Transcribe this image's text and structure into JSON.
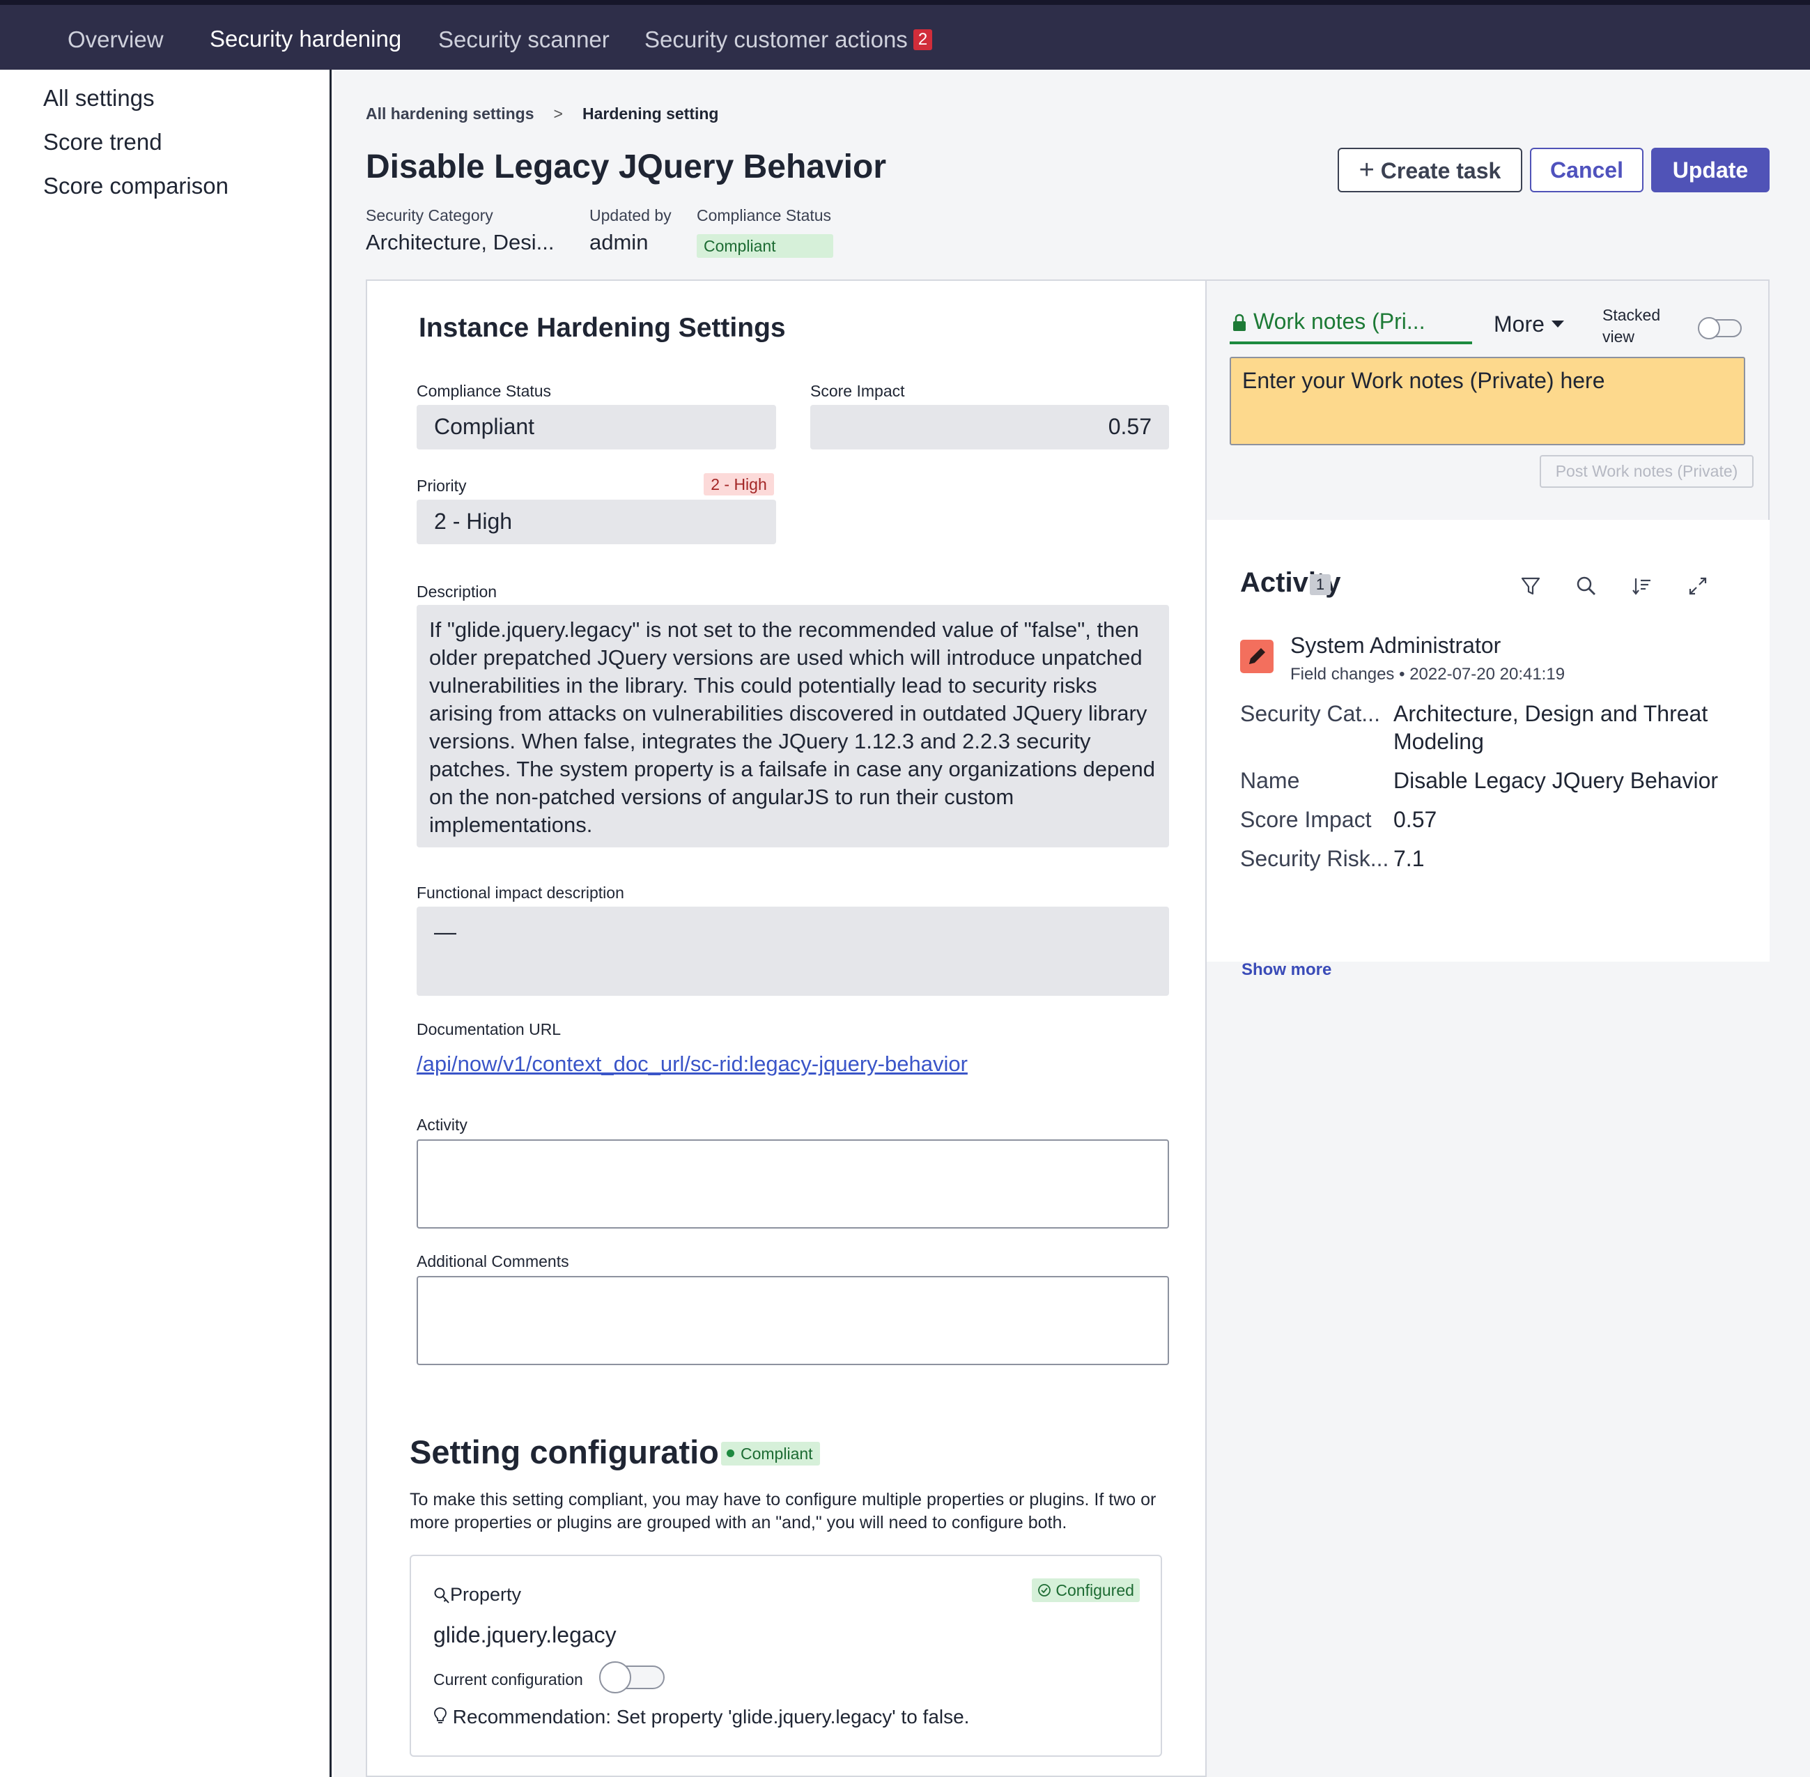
{
  "nav": {
    "tabs": [
      {
        "label": "Overview"
      },
      {
        "label": "Security hardening"
      },
      {
        "label": "Security scanner"
      },
      {
        "label": "Security customer actions",
        "badge": "2"
      }
    ],
    "active_tab": "Security hardening"
  },
  "sidebar": {
    "items": [
      {
        "label": "All settings"
      },
      {
        "label": "Score trend"
      },
      {
        "label": "Score comparison"
      }
    ]
  },
  "breadcrumb": {
    "parent": "All hardening settings",
    "current": "Hardening setting"
  },
  "page": {
    "title": "Disable Legacy JQuery Behavior",
    "meta": {
      "category_label": "Security Category",
      "category_value": "Architecture, Desi...",
      "updated_label": "Updated by",
      "updated_value": "admin",
      "status_label": "Compliance Status",
      "status_value": "Compliant"
    },
    "buttons": {
      "create_task": "Create task",
      "cancel": "Cancel",
      "update": "Update"
    }
  },
  "form": {
    "heading": "Instance Hardening Settings",
    "compliance_status_label": "Compliance Status",
    "compliance_status_value": "Compliant",
    "score_impact_label": "Score Impact",
    "score_impact_value": "0.57",
    "priority_label": "Priority",
    "priority_chip": "2 - High",
    "priority_value": "2 - High",
    "description_label": "Description",
    "description_value": "If \"glide.jquery.legacy\" is not set to the recommended value of \"false\", then older prepatched JQuery versions are used which will introduce unpatched vulnerabilities in the library. This could potentially lead to security risks arising from attacks on vulnerabilities discovered in outdated JQuery library versions. When false, integrates the JQuery 1.12.3 and 2.2.3 security patches. The system property is a failsafe in case any organizations depend on the non-patched versions of angularJS to run their custom implementations.",
    "functional_impact_label": "Functional impact description",
    "functional_impact_value": "—",
    "doc_url_label": "Documentation URL",
    "doc_url_value": "/api/now/v1/context_doc_url/sc-rid:legacy-jquery-behavior",
    "activity_label": "Activity",
    "additional_comments_label": "Additional Comments"
  },
  "setting_config": {
    "heading": "Setting configuration",
    "status": "Compliant",
    "description": "To make this setting compliant, you may have to configure multiple properties or plugins. If two or more properties or plugins are grouped with an \"and,\" you will need to configure both.",
    "property_label": "Property",
    "property_name": "glide.jquery.legacy",
    "configured_label": "Configured",
    "current_config_label": "Current configuration",
    "current_config_on": false,
    "recommendation_label": "Recommendation:",
    "recommendation_text": "Set property 'glide.jquery.legacy' to false."
  },
  "work_notes": {
    "tab_label": "Work notes (Pri...",
    "more_label": "More",
    "stacked_label": "Stacked view",
    "stacked_on": false,
    "placeholder": "Enter your Work notes (Private) here",
    "post_button": "Post Work notes (Private)"
  },
  "activity": {
    "title": "Activity",
    "count": "1",
    "author": "System Administrator",
    "entry_type": "Field changes",
    "timestamp": "2022-07-20 20:41:19",
    "fields": [
      {
        "key": "Security Cat...",
        "value": "Architecture, Design and Threat Modeling"
      },
      {
        "key": "Name",
        "value": "Disable Legacy JQuery Behavior"
      },
      {
        "key": "Score Impact",
        "value": "0.57"
      },
      {
        "key": "Security Risk...",
        "value": "7.1"
      }
    ],
    "show_more": "Show more"
  },
  "colors": {
    "nav_bg": "#2e2e49",
    "primary": "#5053b7",
    "compliant_bg": "#d6f0d9",
    "work_notes_bg": "#fdd98d",
    "high_priority_bg": "#fcdad9"
  }
}
